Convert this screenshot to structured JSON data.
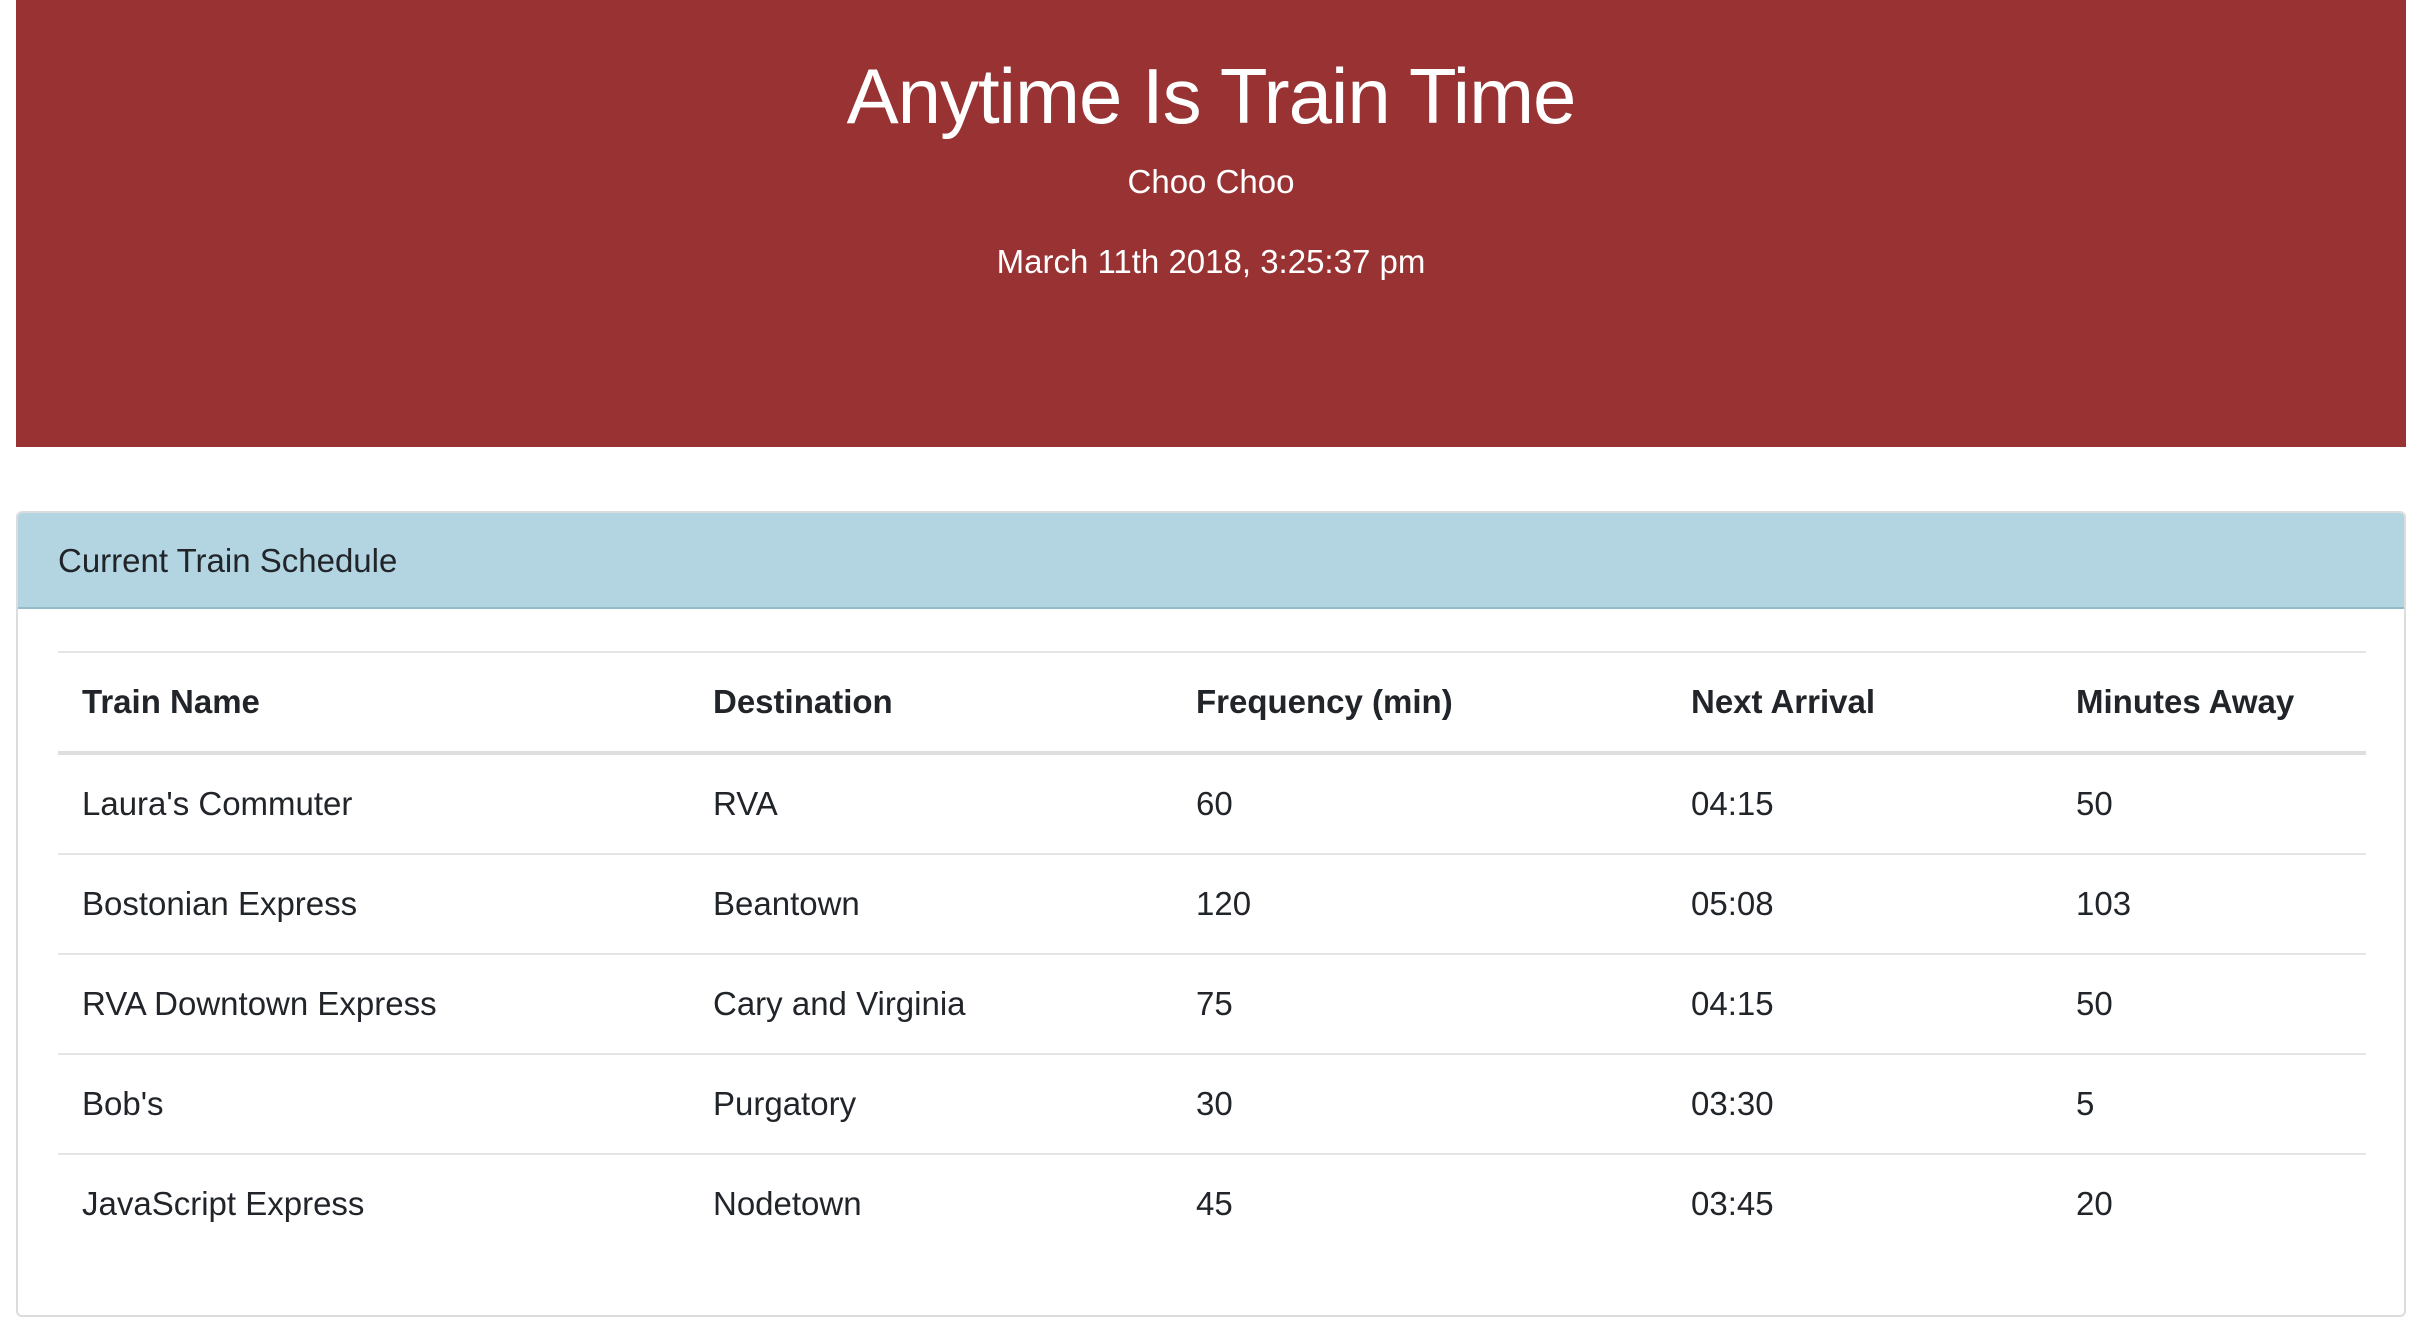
{
  "header": {
    "title": "Anytime Is Train Time",
    "subtitle": "Choo Choo",
    "current_time": "March 11th 2018, 3:25:37 pm"
  },
  "schedule": {
    "title": "Current Train Schedule",
    "columns": [
      "Train Name",
      "Destination",
      "Frequency (min)",
      "Next Arrival",
      "Minutes Away"
    ],
    "rows": [
      [
        "Laura's Commuter",
        "RVA",
        "60",
        "04:15",
        "50"
      ],
      [
        "Bostonian Express",
        "Beantown",
        "120",
        "05:08",
        "103"
      ],
      [
        "RVA Downtown Express",
        "Cary and Virginia",
        "75",
        "04:15",
        "50"
      ],
      [
        "Bob's",
        "Purgatory",
        "30",
        "03:30",
        "5"
      ],
      [
        "JavaScript Express",
        "Nodetown",
        "45",
        "03:45",
        "20"
      ]
    ]
  },
  "colors": {
    "header_background": "#993333",
    "card_header_background": "#b3d5e2"
  }
}
